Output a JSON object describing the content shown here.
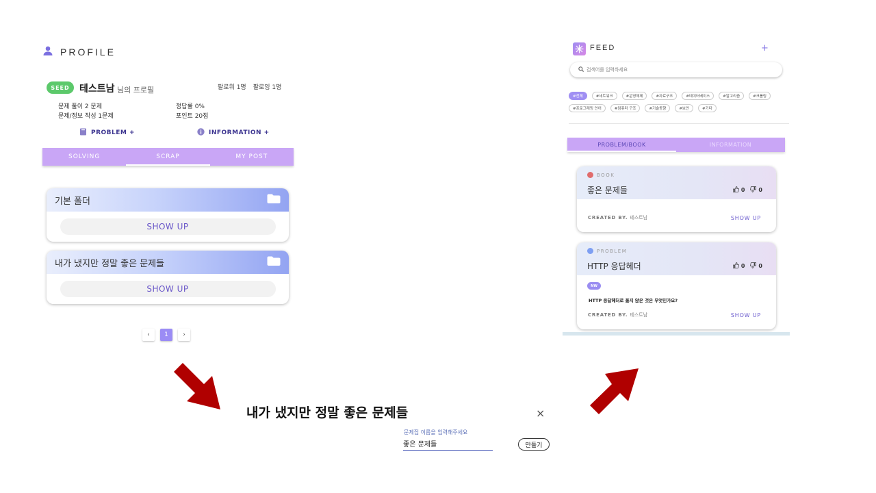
{
  "profile": {
    "header": "PROFILE",
    "badge": "SEED",
    "user_name": "테스트남",
    "user_suffix": "님의 프로필",
    "followers": "팔로워 1명",
    "following": "팔로잉 1명",
    "stats": {
      "solved": "문제 풀이 2 문제",
      "written": "문제/정보 작성 1문제",
      "accuracy": "정답률 0%",
      "points": "포인트 20점"
    },
    "problem_link": "PROBLEM +",
    "information_link": "INFORMATION +",
    "tabs": [
      "SOLVING",
      "SCRAP",
      "MY POST"
    ],
    "active_tab": "SCRAP",
    "folders": [
      {
        "name": "기본 폴더",
        "action": "SHOW UP"
      },
      {
        "name": "내가 냈지만 정말 좋은 문제들",
        "action": "SHOW UP"
      }
    ],
    "pager": {
      "prev": "‹",
      "current": "1",
      "next": "›"
    }
  },
  "dialog": {
    "title": "내가 냈지만 정말 좋은 문제들",
    "close": "×",
    "label": "문제집 이름을 입력해주세요",
    "value": "좋은 문제들",
    "create_button": "만들기"
  },
  "feed": {
    "title": "FEED",
    "plus": "+",
    "search_placeholder": "검색어를 입력하세요",
    "tags": [
      "#전체",
      "#네트워크",
      "#운영체제",
      "#자료구조",
      "#데이터베이스",
      "#알고리즘",
      "#크롤링",
      "#프로그래밍 언어",
      "#컴퓨터 구조",
      "#기술동향",
      "#보안",
      "#기타"
    ],
    "active_tag": "#전체",
    "tabs": [
      "PROBLEM/BOOK",
      "INFORMATION"
    ],
    "posts": [
      {
        "kind": "BOOK",
        "dot_color": "#e06c6c",
        "title": "좋은 문제들",
        "likes": "0",
        "dislikes": "0",
        "created_by_label": "CREATED BY.",
        "author": "테스트남",
        "action": "SHOW UP"
      },
      {
        "kind": "PROBLEM",
        "dot_color": "#7e9ff2",
        "title": "HTTP 응답헤더",
        "likes": "0",
        "dislikes": "0",
        "badge": "NW",
        "question": "HTTP 응답헤더로 옳지 않은 것은 무엇인가요?",
        "created_by_label": "CREATED BY.",
        "author": "테스트남",
        "action": "SHOW UP"
      }
    ]
  },
  "colors": {
    "accent_purple": "#c9a6f6",
    "seed_green": "#5cc96b",
    "arrow_red": "#b00000",
    "link_purple": "#6a57c9"
  },
  "icons": [
    "user-icon",
    "book-icon",
    "info-icon",
    "folder-icon",
    "search-icon",
    "thumb-up-icon",
    "thumb-down-icon",
    "close-icon",
    "arrow-icon"
  ]
}
